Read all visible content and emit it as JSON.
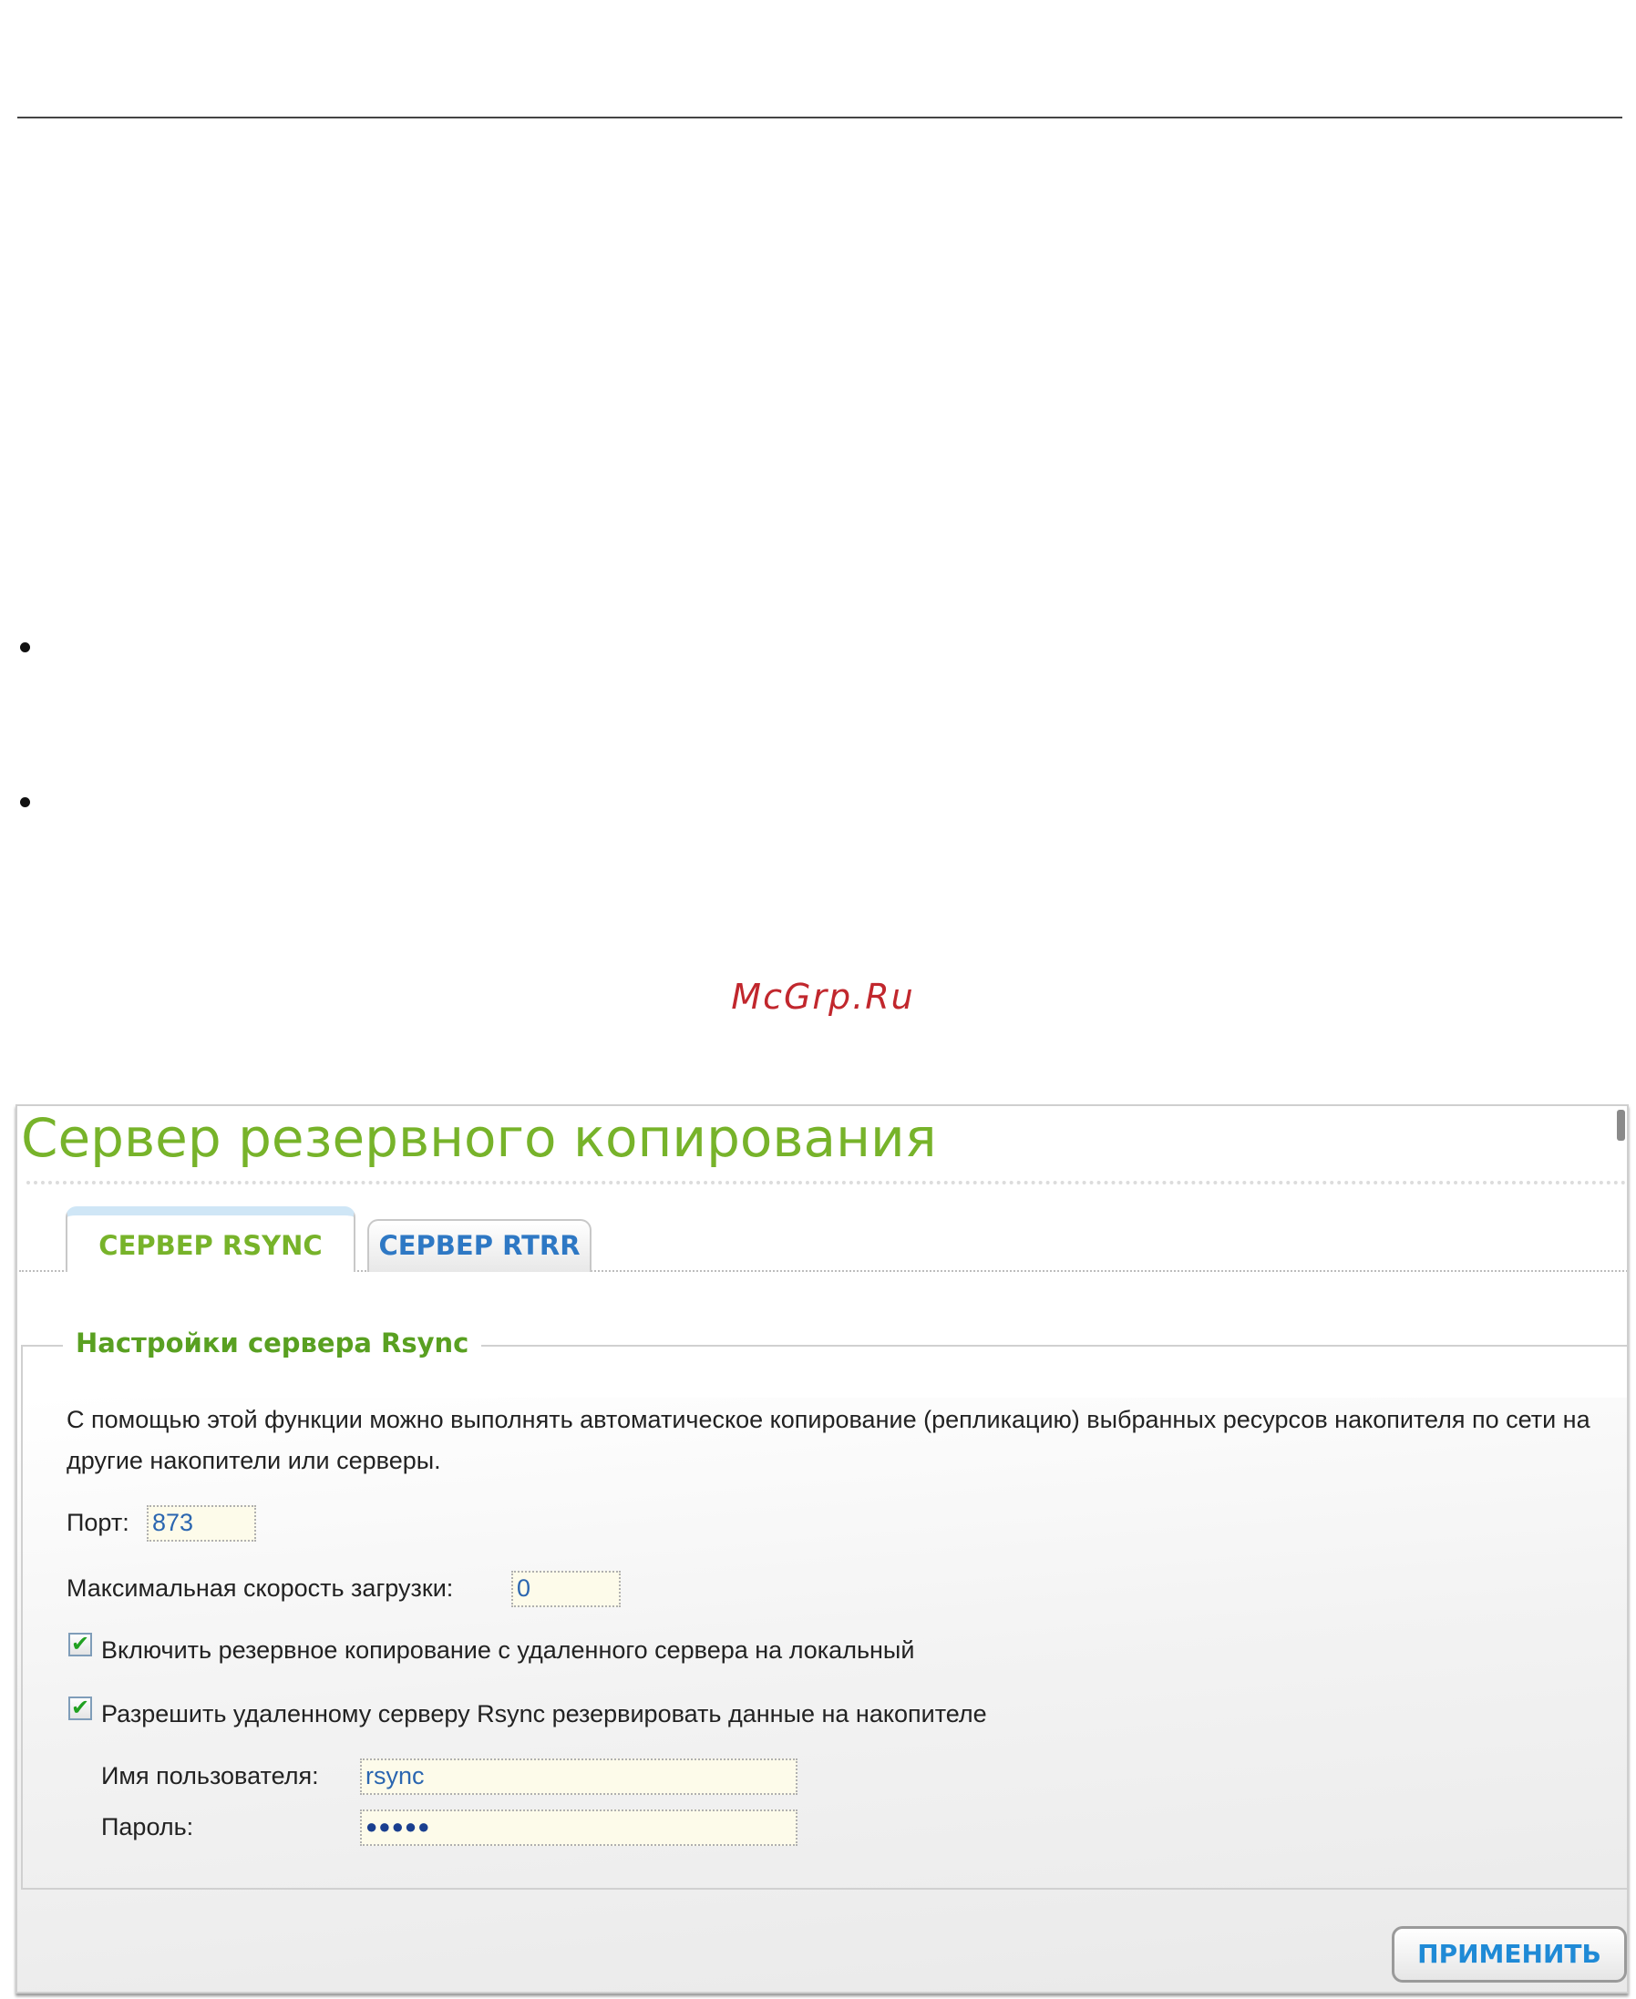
{
  "watermark": "McGrp.Ru",
  "panel": {
    "title": "Сервер резервного копирования",
    "tabs": [
      {
        "label": "СЕРВЕР RSYNC",
        "active": true
      },
      {
        "label": "СЕРВЕР RTRR",
        "active": false
      }
    ],
    "section_title": "Настройки сервера Rsync",
    "description": "С помощью этой функции можно выполнять автоматическое копирование (репликацию) выбранных ресурсов накопителя по сети на другие накопители или серверы.",
    "port": {
      "label": "Порт:",
      "value": "873"
    },
    "max_speed": {
      "label": "Максимальная скорость загрузки:",
      "value": "0"
    },
    "enable_backup": {
      "label": "Включить резервное копирование с удаленного сервера на локальный",
      "checked": true
    },
    "allow_remote": {
      "label": "Разрешить удаленному серверу Rsync резервировать данные на накопителе",
      "checked": true
    },
    "username": {
      "label": "Имя пользователя:",
      "value": "rsync"
    },
    "password": {
      "label": "Пароль:",
      "value": "●●●●●"
    },
    "apply_label": "ПРИМЕНИТЬ"
  },
  "colors": {
    "title_green": "#77b32a",
    "tab_blue": "#2e78c4",
    "watermark_red": "#c1272d",
    "input_bg": "#fdfbea"
  }
}
